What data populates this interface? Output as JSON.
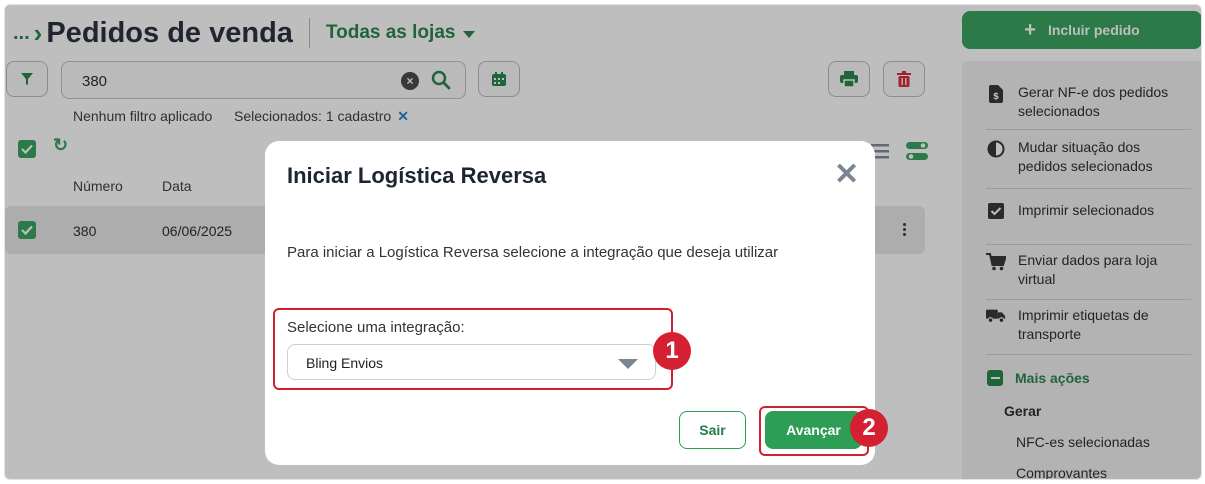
{
  "header": {
    "breadcrumb_dots": "...",
    "title": "Pedidos de venda",
    "store_selector": "Todas as lojas"
  },
  "toolbar": {
    "search_value": "380",
    "filter_info": "Nenhum filtro aplicado",
    "selection_info": "Selecionados: 1 cadastro",
    "selection_clear": "✕"
  },
  "table": {
    "columns": [
      "Número",
      "Data"
    ],
    "rows": [
      {
        "numero": "380",
        "data": "06/06/2025",
        "checked": true
      }
    ]
  },
  "sidebar": {
    "primary_button": "Incluir pedido",
    "actions": [
      {
        "label": "Gerar NF-e dos pedidos selecionados",
        "icon": "invoice-icon"
      },
      {
        "label": "Mudar situação dos pedidos selecionados",
        "icon": "half-circle-icon"
      },
      {
        "label": "Imprimir selecionados",
        "icon": "checkbox-icon"
      },
      {
        "label": "Enviar dados para loja virtual",
        "icon": "cart-icon"
      },
      {
        "label": "Imprimir etiquetas de transporte",
        "icon": "truck-icon"
      }
    ],
    "more_actions": "Mais ações",
    "group_label": "Gerar",
    "sub_items": [
      "NFC-es selecionadas",
      "Comprovantes"
    ]
  },
  "modal": {
    "title": "Iniciar Logística Reversa",
    "close": "✕",
    "description": "Para iniciar a Logística Reversa selecione a integração que deseja utilizar",
    "select_label": "Selecione uma integração:",
    "select_value": "Bling Envios",
    "cancel_label": "Sair",
    "confirm_label": "Avançar"
  },
  "annotations": {
    "badge1": "1",
    "badge2": "2"
  },
  "colors": {
    "brand_green": "#2e9e56",
    "dark_green": "#1e7e43",
    "danger_red": "#d42032"
  }
}
